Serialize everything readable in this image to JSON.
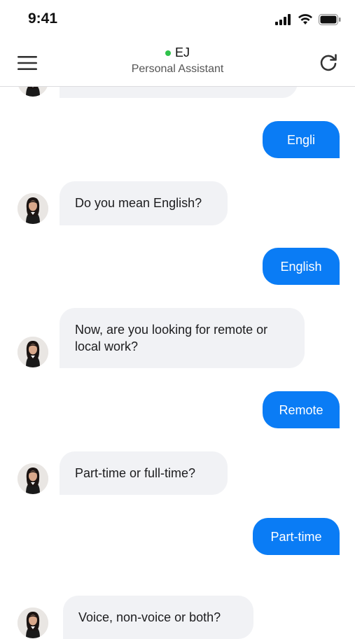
{
  "status_bar": {
    "time": "9:41",
    "icons": [
      "signal-icon",
      "wifi-icon",
      "battery-icon"
    ]
  },
  "header": {
    "contact_name": "EJ",
    "contact_role": "Personal Assistant",
    "online_color": "#2fc24b",
    "left_icon": "menu-icon",
    "right_icon": "refresh-icon"
  },
  "colors": {
    "user_bubble": "#0a7cf5",
    "bot_bubble": "#f1f2f5"
  },
  "messages": [
    {
      "sender": "bot",
      "text": ""
    },
    {
      "sender": "user",
      "text": "Engli"
    },
    {
      "sender": "bot",
      "text": "Do you mean English?"
    },
    {
      "sender": "user",
      "text": "English"
    },
    {
      "sender": "bot",
      "text": "Now, are you looking for remote or local work?"
    },
    {
      "sender": "user",
      "text": "Remote"
    },
    {
      "sender": "bot",
      "text": "Part-time or full-time?"
    },
    {
      "sender": "user",
      "text": "Part-time"
    },
    {
      "sender": "bot",
      "text": "Voice, non-voice or both?"
    }
  ]
}
